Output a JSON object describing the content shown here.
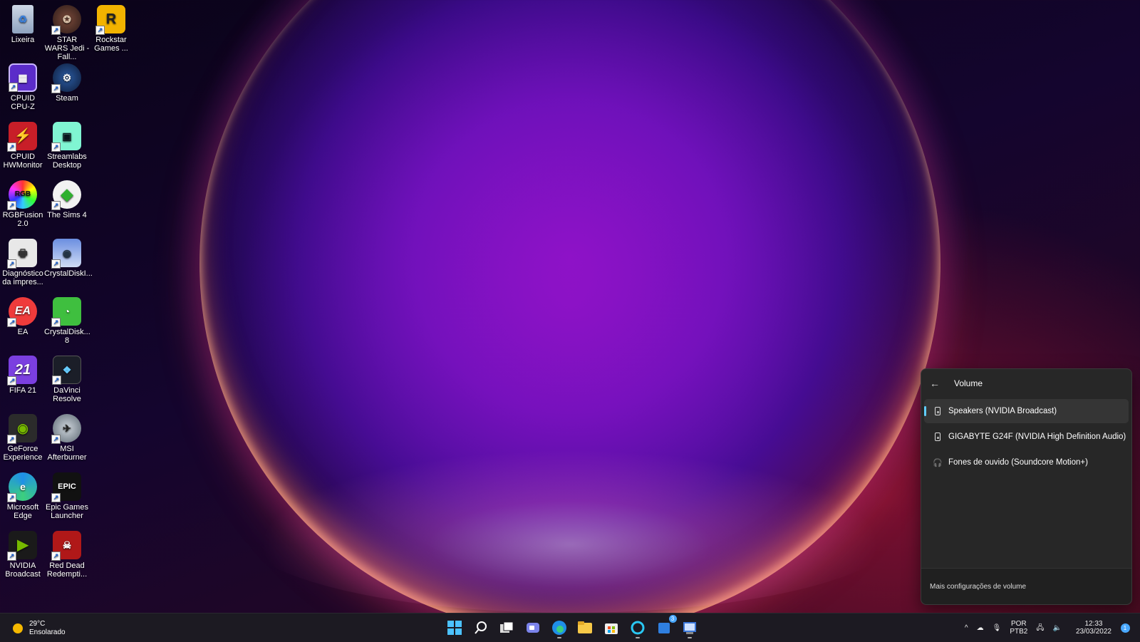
{
  "desktop": {
    "icons": [
      {
        "label": "Lixeira",
        "icon": "recycle-bin-icon"
      },
      {
        "label": "STAR WARS Jedi - Fall...",
        "icon": "star-wars-icon"
      },
      {
        "label": "Rockstar Games ...",
        "icon": "rockstar-icon"
      },
      {
        "label": "CPUID CPU-Z",
        "icon": "cpu-z-icon"
      },
      {
        "label": "Steam",
        "icon": "steam-icon"
      },
      {
        "label": "CPUID HWMonitor",
        "icon": "hwmonitor-icon"
      },
      {
        "label": "Streamlabs Desktop",
        "icon": "streamlabs-icon"
      },
      {
        "label": "RGBFusion 2.0",
        "icon": "rgbfusion-icon"
      },
      {
        "label": "The Sims 4",
        "icon": "sims-icon"
      },
      {
        "label": "Diagnóstico da impres...",
        "icon": "printer-diagnostic-icon"
      },
      {
        "label": "CrystalDiskI...",
        "icon": "crystaldiskinfo-icon"
      },
      {
        "label": "EA",
        "icon": "ea-icon"
      },
      {
        "label": "CrystalDisk... 8",
        "icon": "crystaldiskmark-icon"
      },
      {
        "label": "FIFA 21",
        "icon": "fifa-icon"
      },
      {
        "label": "DaVinci Resolve",
        "icon": "davinci-icon"
      },
      {
        "label": "GeForce Experience",
        "icon": "geforce-icon"
      },
      {
        "label": "MSI Afterburner",
        "icon": "afterburner-icon"
      },
      {
        "label": "Microsoft Edge",
        "icon": "edge-icon"
      },
      {
        "label": "Epic Games Launcher",
        "icon": "epic-games-icon"
      },
      {
        "label": "NVIDIA Broadcast",
        "icon": "nvidia-broadcast-icon"
      },
      {
        "label": "Red Dead Redempti...",
        "icon": "red-dead-icon"
      }
    ]
  },
  "volume_flyout": {
    "title": "Volume",
    "devices": [
      {
        "label": "Speakers (NVIDIA Broadcast)",
        "selected": true,
        "icon": "speaker-icon"
      },
      {
        "label": "GIGABYTE G24F (NVIDIA High Definition Audio)",
        "selected": false,
        "icon": "speaker-icon"
      },
      {
        "label": "Fones de ouvido (Soundcore Motion+)",
        "selected": false,
        "icon": "headphones-icon"
      }
    ],
    "footer_link": "Mais configurações de volume"
  },
  "taskbar": {
    "weather": {
      "temp": "29°C",
      "condition": "Ensolarado"
    },
    "apps": [
      "start",
      "search",
      "task-view",
      "teams",
      "edge",
      "file-explorer",
      "store",
      "cortana",
      "todo",
      "app-extra"
    ],
    "todo_badge": "3",
    "tray": {
      "lang_top": "POR",
      "lang_bottom": "PTB2",
      "time": "12:33",
      "date": "23/03/2022",
      "notif_badge": "1"
    }
  },
  "colors": {
    "accent": "#60cdff",
    "flyout_bg": "#272727",
    "taskbar_bg": "#1c1a22"
  }
}
